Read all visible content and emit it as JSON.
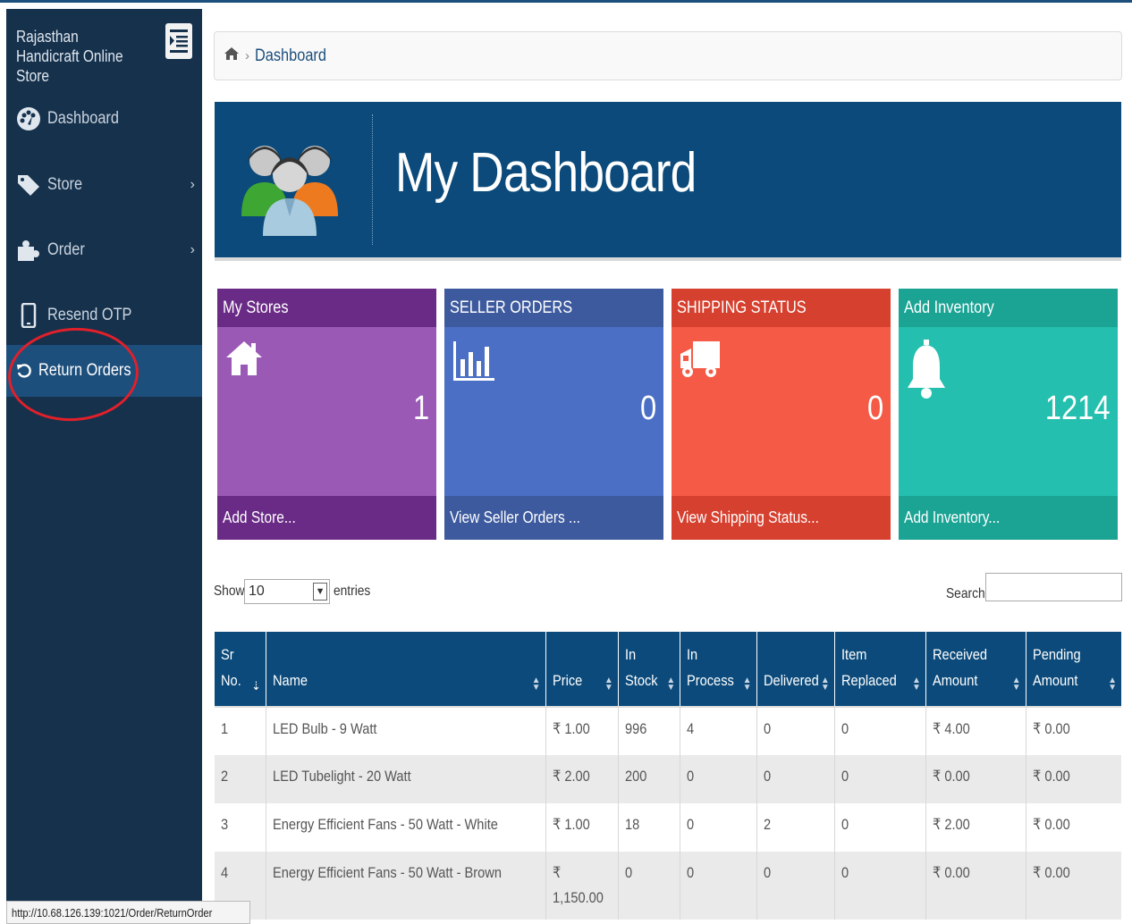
{
  "app": {
    "brand": "Rajasthan Handicraft Online Store"
  },
  "sidebar": {
    "items": [
      {
        "label": "Dashboard",
        "icon": "dashboard-icon"
      },
      {
        "label": "Store",
        "icon": "tag-icon",
        "has_submenu": true
      },
      {
        "label": "Order",
        "icon": "puzzle-icon",
        "has_submenu": true
      },
      {
        "label": "Resend OTP",
        "icon": "mobile-icon"
      },
      {
        "label": "Return Orders",
        "icon": "undo-icon",
        "active": true
      }
    ]
  },
  "breadcrumb": {
    "current": "Dashboard"
  },
  "banner": {
    "title": "My Dashboard"
  },
  "tiles": [
    {
      "title": "My Stores",
      "count": "1",
      "footer": "Add Store...",
      "icon": "home-icon",
      "color": "#9b59b6"
    },
    {
      "title": "SELLER ORDERS",
      "count": "0",
      "footer": "View Seller Orders ...",
      "icon": "bar-chart-icon",
      "color": "#4a6fc4"
    },
    {
      "title": "SHIPPING STATUS",
      "count": "0",
      "footer": "View Shipping Status...",
      "icon": "truck-icon",
      "color": "#f55a46"
    },
    {
      "title": "Add Inventory",
      "count": "1214",
      "footer": "Add Inventory...",
      "icon": "bell-icon",
      "color": "#24bfae"
    }
  ],
  "table_controls": {
    "show_label": "Show",
    "page_size": "10",
    "entries_label": "entries",
    "search_label": "Search:"
  },
  "table": {
    "columns": [
      [
        "Sr",
        "No."
      ],
      [
        "Name"
      ],
      [
        "Price"
      ],
      [
        "In",
        "Stock"
      ],
      [
        "In",
        "Process"
      ],
      [
        "Delivered"
      ],
      [
        "Item",
        "Replaced"
      ],
      [
        "Received",
        "Amount"
      ],
      [
        "Pending",
        "Amount"
      ]
    ],
    "rows": [
      [
        "1",
        "LED Bulb - 9 Watt",
        "₹ 1.00",
        "996",
        "4",
        "0",
        "0",
        "₹ 4.00",
        "₹ 0.00"
      ],
      [
        "2",
        "LED Tubelight - 20 Watt",
        "₹ 2.00",
        "200",
        "0",
        "0",
        "0",
        "₹ 0.00",
        "₹ 0.00"
      ],
      [
        "3",
        "Energy Efficient Fans - 50 Watt - White",
        "₹ 1.00",
        "18",
        "0",
        "2",
        "0",
        "₹ 2.00",
        "₹ 0.00"
      ],
      [
        "4",
        "Energy Efficient Fans - 50 Watt - Brown",
        "₹\n1,150.00",
        "0",
        "0",
        "0",
        "0",
        "₹ 0.00",
        "₹ 0.00"
      ]
    ]
  },
  "statusbar": {
    "url": "http://10.68.126.139:1021/Order/ReturnOrder"
  }
}
